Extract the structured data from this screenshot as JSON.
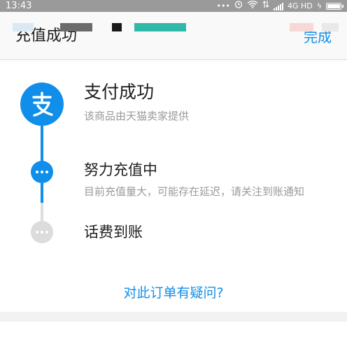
{
  "status_bar": {
    "time": "13:43",
    "dots": "•••",
    "network": "4G HD",
    "charging": "ϟ",
    "battery_level": 1.0
  },
  "header": {
    "title": "充值成功",
    "done_label": "完成"
  },
  "steps": [
    {
      "title": "支付成功",
      "desc": "该商品由天猫卖家提供",
      "icon": "alipay-icon",
      "status": "done"
    },
    {
      "title": "努力充值中",
      "desc": "目前充值量大，可能存在延迟，请关注到账通知",
      "icon": "more-dots-icon",
      "status": "active"
    },
    {
      "title": "话费到账",
      "desc": "",
      "icon": "more-dots-icon",
      "status": "pending"
    }
  ],
  "question_link": "对此订单有疑问?",
  "colors": {
    "accent": "#108ee9",
    "status_bar": "#9a9a9a",
    "text_primary": "#1d1d1d",
    "text_secondary": "#9a9a9a",
    "inactive": "#dcdcdc"
  }
}
